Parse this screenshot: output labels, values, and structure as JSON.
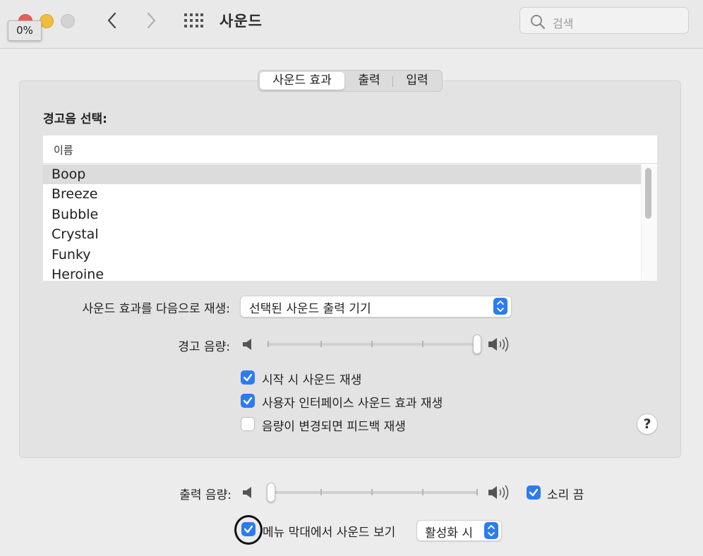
{
  "window": {
    "progress_tooltip": "0%",
    "title": "사운드",
    "search_placeholder": "검색"
  },
  "tabs": [
    {
      "label": "사운드 효과",
      "active": true
    },
    {
      "label": "출력",
      "active": false
    },
    {
      "label": "입력",
      "active": false
    }
  ],
  "alert_sounds": {
    "section_title": "경고음 선택:",
    "column_header": "이름",
    "items": [
      "Boop",
      "Breeze",
      "Bubble",
      "Crystal",
      "Funky",
      "Heroine"
    ],
    "selected": "Boop"
  },
  "play_through": {
    "label": "사운드 효과를 다음으로 재생:",
    "value": "선택된 사운드 출력 기기"
  },
  "alert_volume": {
    "label": "경고 음량:",
    "level": 1.0
  },
  "options": [
    {
      "label": "시작 시 사운드 재생",
      "checked": true
    },
    {
      "label": "사용자 인터페이스 사운드 효과 재생",
      "checked": true
    },
    {
      "label": "음량이 변경되면 피드백 재생",
      "checked": false
    }
  ],
  "help_label": "?",
  "output_volume": {
    "label": "출력 음량:",
    "level": 0.0,
    "mute_label": "소리 끔",
    "mute_checked": true
  },
  "menu_bar": {
    "label": "메뉴 막대에서 사운드 보기",
    "checked": true,
    "popup_value": "활성화 시"
  },
  "colors": {
    "accent": "#2b7cf0",
    "background": "#ececec",
    "panel": "#e3e3e3"
  }
}
